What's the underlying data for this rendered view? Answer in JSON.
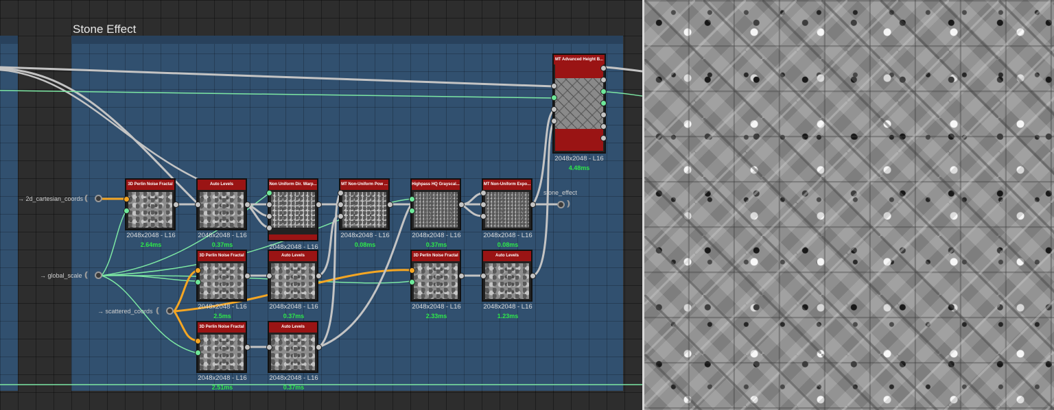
{
  "frame": {
    "title": "Stone Effect"
  },
  "inputs": [
    {
      "key": "cartesian",
      "label": "→ 2d_cartesian_coords"
    },
    {
      "key": "scale",
      "label": "→ global_scale"
    },
    {
      "key": "scattered",
      "label": "→ scattered_coords"
    }
  ],
  "outputs": [
    {
      "key": "stone",
      "label": "stone_effect"
    }
  ],
  "nodes": [
    {
      "id": "perlin1",
      "title": "3D Perlin Noise Fractal",
      "resolution": "2048x2048 - L16",
      "time": "2.64ms"
    },
    {
      "id": "autolevels1",
      "title": "Auto Levels",
      "resolution": "2048x2048 - L16",
      "time": "0.37ms"
    },
    {
      "id": "warp",
      "title": "Non Uniform Dir. Warp...",
      "resolution": "2048x2048 - L16",
      "time": ""
    },
    {
      "id": "pow",
      "title": "MT Non-Uniform Pow ...",
      "resolution": "2048x2048 - L16",
      "time": "0.08ms"
    },
    {
      "id": "highpass",
      "title": "Highpass HQ Grayscal...",
      "resolution": "2048x2048 - L16",
      "time": "0.37ms"
    },
    {
      "id": "expo",
      "title": "MT Non-Uniform Expo...",
      "resolution": "2048x2048 - L16",
      "time": "0.08ms"
    },
    {
      "id": "perlin2",
      "title": "3D Perlin Noise Fractal",
      "resolution": "2048x2048 - L16",
      "time": "2.5ms"
    },
    {
      "id": "autolevels2",
      "title": "Auto Levels",
      "resolution": "2048x2048 - L16",
      "time": "0.37ms"
    },
    {
      "id": "perlin3",
      "title": "3D Perlin Noise Fractal",
      "resolution": "2048x2048 - L16",
      "time": "2.33ms"
    },
    {
      "id": "autolevels3",
      "title": "Auto Levels",
      "resolution": "2048x2048 - L16",
      "time": "1.23ms"
    },
    {
      "id": "perlin4",
      "title": "3D Perlin Noise Fractal",
      "resolution": "2048x2048 - L16",
      "time": "2.51ms"
    },
    {
      "id": "autolevels4",
      "title": "Auto Levels",
      "resolution": "2048x2048 - L16",
      "time": "0.37ms"
    },
    {
      "id": "heightblend",
      "title": "MT Advanced Height B...",
      "resolution": "2048x2048 - L16",
      "time": "4.48ms"
    }
  ],
  "colors": {
    "frame": "#31506f",
    "node_header": "#9a1414",
    "wire_gray": "#c4c4c4",
    "wire_green": "#7de8a4",
    "wire_orange": "#f5a623",
    "timing": "#2ee84a"
  }
}
